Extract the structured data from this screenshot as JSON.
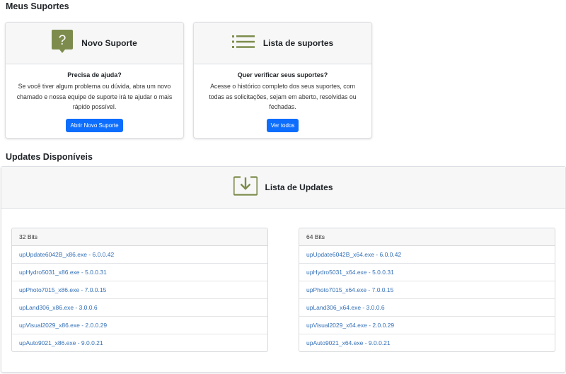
{
  "suportes": {
    "title": "Meus Suportes",
    "novo": {
      "header_title": "Novo Suporte",
      "icon": "question-bubble-icon",
      "question": "Precisa de ajuda?",
      "description": "Se você tiver algum problema ou dúvida, abra um novo chamado e nossa equipe de suporte irá te ajudar o mais rápido possível.",
      "button": "Abrir Novo Suporte"
    },
    "lista": {
      "header_title": "Lista de suportes",
      "icon": "list-icon",
      "question": "Quer verificar seus suportes?",
      "description": "Acesse o histórico completo dos seus suportes, com todas as solicitações, sejam em aberto, resolvidas ou fechadas.",
      "button": "Ver todos"
    }
  },
  "updates": {
    "title": "Updates Disponíveis",
    "header_title": "Lista de Updates",
    "icon": "download-tray-icon",
    "col32": {
      "label": "32 Bits",
      "items": [
        "upUpdate6042B_x86.exe - 6.0.0.42",
        "upHydro5031_x86.exe - 5.0.0.31",
        "upPhoto7015_x86.exe - 7.0.0.15",
        "upLand306_x86.exe - 3.0.0.6",
        "upVisual2029_x86.exe - 2.0.0.29",
        "upAuto9021_x86.exe - 9.0.0.21"
      ]
    },
    "col64": {
      "label": "64 Bits",
      "items": [
        "upUpdate6042B_x64.exe - 6.0.0.42",
        "upHydro5031_x64.exe - 5.0.0.31",
        "upPhoto7015_x64.exe - 7.0.0.15",
        "upLand306_x64.exe - 3.0.0.6",
        "upVisual2029_x64.exe - 2.0.0.29",
        "upAuto9021_x64.exe - 9.0.0.21"
      ]
    }
  },
  "colors": {
    "accent_olive": "#7d8c4d",
    "primary": "#0d6efd",
    "link": "#3470b7"
  }
}
